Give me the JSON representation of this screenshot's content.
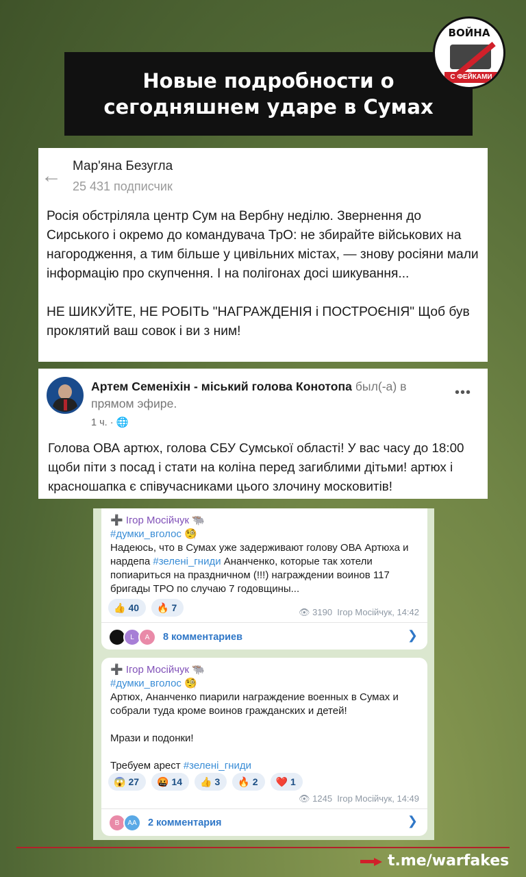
{
  "header": {
    "title_line1": "Новые подробности о",
    "title_line2": "сегодняшнем ударе в Сумах",
    "logo_top": "ВОЙНА",
    "logo_bottom": "С ФЕЙКАМИ"
  },
  "post1": {
    "name": "Мар'яна Безугла",
    "subscribers": "25 431 подписчик",
    "p1": "Росія обстріляла центр Сум на Вербну неділю. Звернення до Сирського і окремо до командувача ТрО: не збирайте військових на нагородження, а тим більше у цивільних містах, — знову росіяни мали інформацію про скупчення. І на полігонах досі шикування...",
    "p2": "НЕ ШИКУЙТЕ, НЕ РОБІТЬ \"НАГРАЖДЕНІЯ і ПОСТРОЄНІЯ\" Щоб був проклятий ваш совок і ви з ним!"
  },
  "post2": {
    "name": "Артем Семеніхін - міський голова Конотопа",
    "status": " был(-а) в прямом эфире.",
    "time": "1 ч. · ",
    "body": "Голова ОВА артюх, голова СБУ Сумської області! У вас часу до 18:00 щоби піти з посад і стати на коліна перед загиблими дітьми! артюх і красношапка є співучасниками цього злочину московитів!"
  },
  "tg1": {
    "author": "➕ Ігор Мосійчук 🐃",
    "hashtag": "#думки_вголос 🧐",
    "text_a": "Надеюсь, что в Сумах уже задерживают голову ОВА Артюха и нардепа ",
    "text_tag": "#зелені_гниди",
    "text_b": " Ананченко, которые так хотели попиариться на праздничном (!!!) награждении воинов 117 бригады ТРО по случаю 7 годовщины...",
    "reactions": [
      {
        "emoji": "👍",
        "count": "40"
      },
      {
        "emoji": "🔥",
        "count": "7"
      }
    ],
    "views": "3190",
    "signature": "Ігор Мосійчук, 14:42",
    "avatars": [
      "",
      "L",
      "A"
    ],
    "comments": "8 комментариев"
  },
  "tg2": {
    "author": "➕ Ігор Мосійчук 🐃",
    "hashtag": "#думки_вголос 🧐",
    "text1": "Артюх, Ананченко пиарили награждение военных в Сумах и собрали туда кроме воинов гражданских и детей!",
    "text2": "Мрази и подонки!",
    "text3_a": "Требуем арест ",
    "text3_tag": "#зелені_гниди",
    "reactions": [
      {
        "emoji": "😱",
        "count": "27"
      },
      {
        "emoji": "🤬",
        "count": "14"
      },
      {
        "emoji": "👍",
        "count": "3"
      },
      {
        "emoji": "🔥",
        "count": "2"
      },
      {
        "emoji": "❤️",
        "count": "1"
      }
    ],
    "views": "1245",
    "signature": "Ігор Мосійчук, 14:49",
    "avatars": [
      "B",
      "AA"
    ],
    "comments": "2 комментария"
  },
  "footer": {
    "link": "t.me/warfakes"
  },
  "colors": {
    "accent_red": "#d0202a",
    "telegram_blue": "#2f77c7",
    "author_purple": "#8050b8"
  }
}
